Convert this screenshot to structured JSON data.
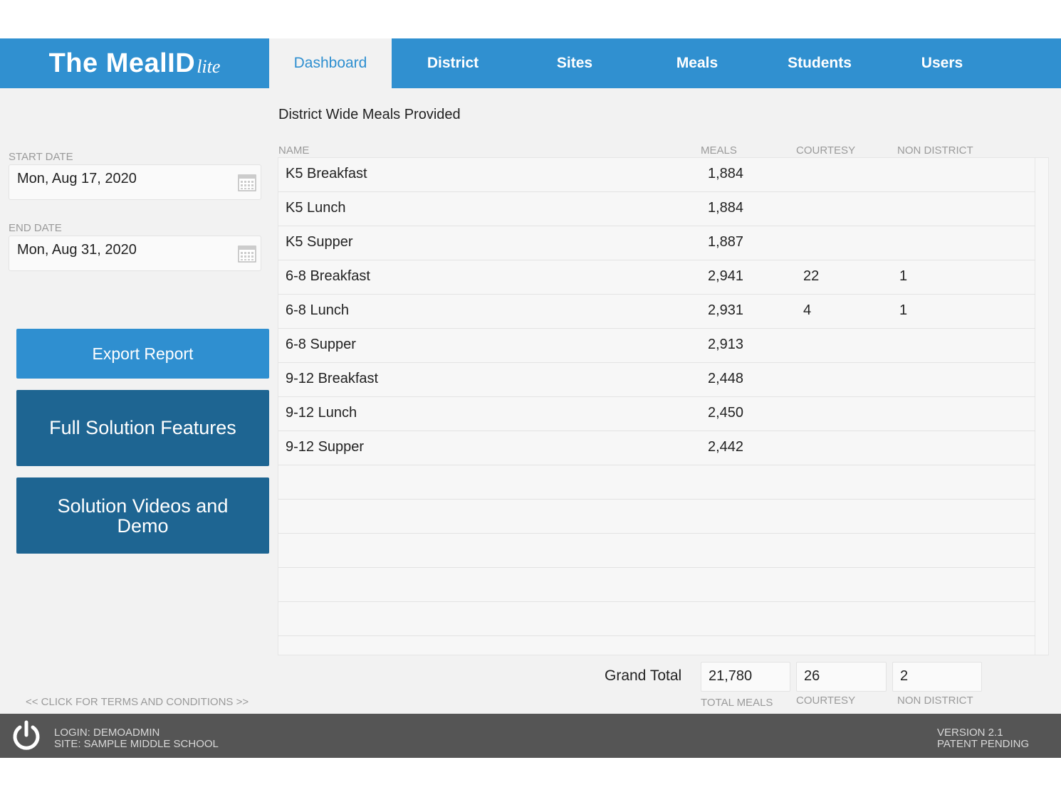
{
  "app": {
    "logo_text": "The MealID",
    "logo_suffix": "lite"
  },
  "nav": {
    "tabs": [
      {
        "label": "Dashboard",
        "active": true
      },
      {
        "label": "District"
      },
      {
        "label": "Sites"
      },
      {
        "label": "Meals"
      },
      {
        "label": "Students"
      },
      {
        "label": "Users"
      }
    ]
  },
  "filters": {
    "start_label": "START DATE",
    "start_value": "Mon, Aug 17, 2020",
    "end_label": "END DATE",
    "end_value": "Mon, Aug 31, 2020"
  },
  "buttons": {
    "export": "Export Report",
    "features": "Full Solution Features",
    "videos": "Solution Videos and Demo"
  },
  "terms": "<< CLICK FOR TERMS AND CONDITIONS >>",
  "report": {
    "title": "District Wide Meals Provided",
    "columns": {
      "name": "NAME",
      "meals": "MEALS",
      "courtesy": "COURTESY",
      "non_district": "NON DISTRICT"
    },
    "rows": [
      {
        "name": "K5 Breakfast",
        "meals": "1,884",
        "courtesy": "",
        "non_district": ""
      },
      {
        "name": "K5 Lunch",
        "meals": "1,884",
        "courtesy": "",
        "non_district": ""
      },
      {
        "name": "K5 Supper",
        "meals": "1,887",
        "courtesy": "",
        "non_district": ""
      },
      {
        "name": "6-8 Breakfast",
        "meals": "2,941",
        "courtesy": "22",
        "non_district": "1"
      },
      {
        "name": "6-8 Lunch",
        "meals": "2,931",
        "courtesy": "4",
        "non_district": "1"
      },
      {
        "name": "6-8 Supper",
        "meals": "2,913",
        "courtesy": "",
        "non_district": ""
      },
      {
        "name": "9-12 Breakfast",
        "meals": "2,448",
        "courtesy": "",
        "non_district": ""
      },
      {
        "name": "9-12 Lunch",
        "meals": "2,450",
        "courtesy": "",
        "non_district": ""
      },
      {
        "name": "9-12 Supper",
        "meals": "2,442",
        "courtesy": "",
        "non_district": ""
      }
    ],
    "empty_rows": 5
  },
  "totals": {
    "label": "Grand Total",
    "meals": "21,780",
    "courtesy": "26",
    "non_district": "2",
    "meals_label": "TOTAL MEALS",
    "courtesy_label": "COURTESY",
    "non_district_label": "NON DISTRICT"
  },
  "footer": {
    "login": "LOGIN: DEMOADMIN",
    "site": "SITE: SAMPLE MIDDLE SCHOOL",
    "version": "VERSION 2.1",
    "patent": "PATENT PENDING"
  },
  "colors": {
    "primary": "#3090d0",
    "dark_button": "#1e6592",
    "footer": "#555555",
    "background": "#f2f2f2"
  }
}
